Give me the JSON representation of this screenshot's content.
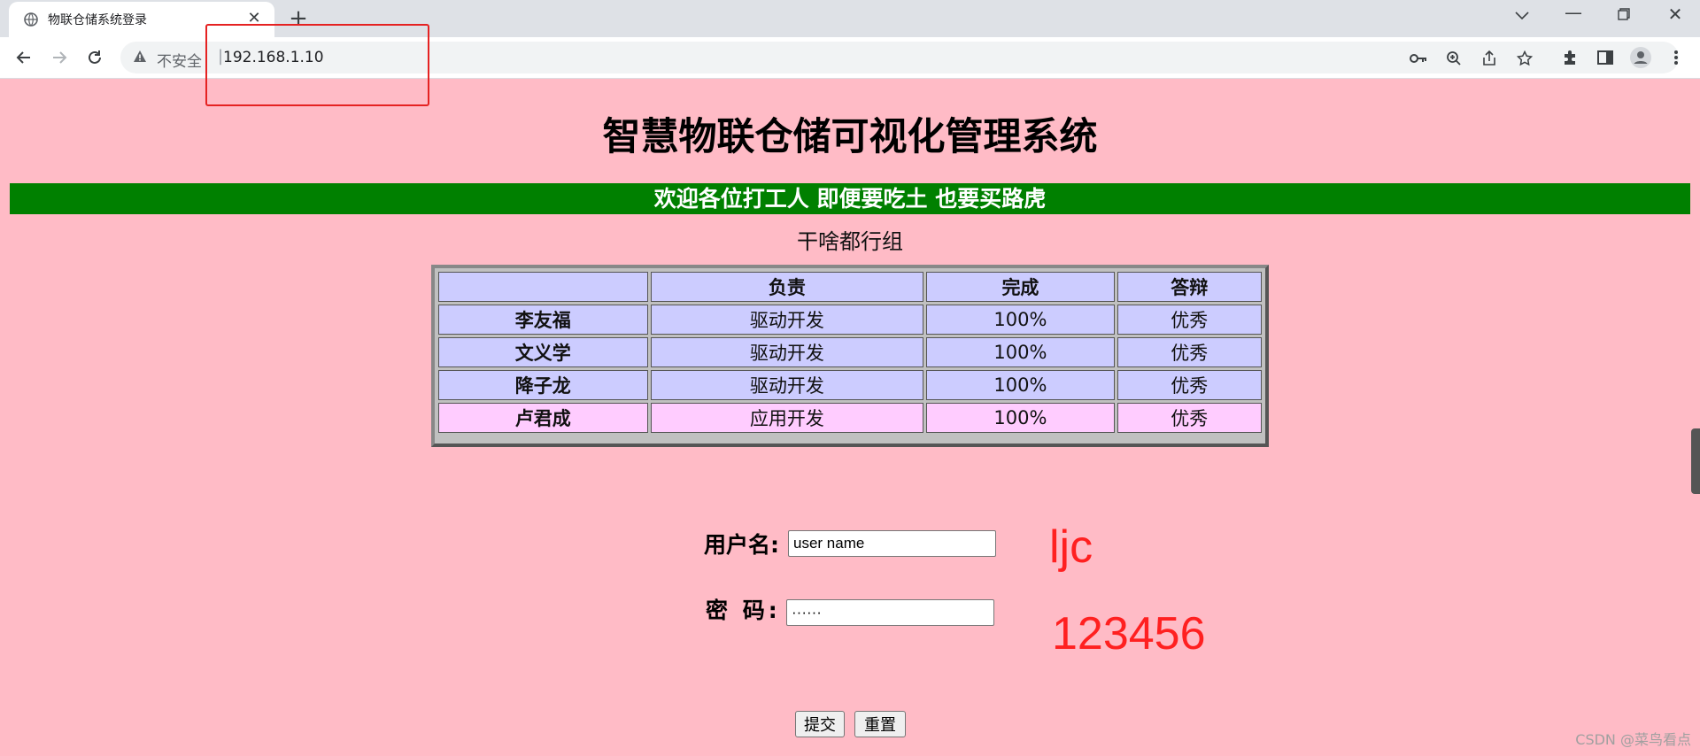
{
  "browser": {
    "tab_title": "物联仓储系统登录",
    "insecure_label": "不安全",
    "url": "192.168.1.10"
  },
  "page": {
    "heading": "智慧物联仓储可视化管理系统",
    "banner": "欢迎各位打工人 即便要吃土 也要买路虎",
    "group": "干啥都行组",
    "table": {
      "headers": [
        "",
        "负责",
        "完成",
        "答辩"
      ],
      "rows": [
        {
          "name": "李友福",
          "role": "驱动开发",
          "done": "100%",
          "grade": "优秀"
        },
        {
          "name": "文义学",
          "role": "驱动开发",
          "done": "100%",
          "grade": "优秀"
        },
        {
          "name": "降子龙",
          "role": "驱动开发",
          "done": "100%",
          "grade": "优秀"
        },
        {
          "name": "卢君成",
          "role": "应用开发",
          "done": "100%",
          "grade": "优秀"
        }
      ]
    },
    "form": {
      "username_label": "用户名:",
      "username_value": "user name",
      "password_label": "密 码:",
      "password_value": "······",
      "submit_label": "提交",
      "reset_label": "重置"
    },
    "annotations": {
      "username_note": "ljc",
      "password_note": "123456"
    },
    "watermark": "CSDN @菜鸟看点"
  },
  "colors": {
    "page_bg": "#ffbbc6",
    "banner_bg": "#008000",
    "row_blue": "#ccccff",
    "row_pink": "#ffccff",
    "annotation_red": "#ff2020"
  }
}
